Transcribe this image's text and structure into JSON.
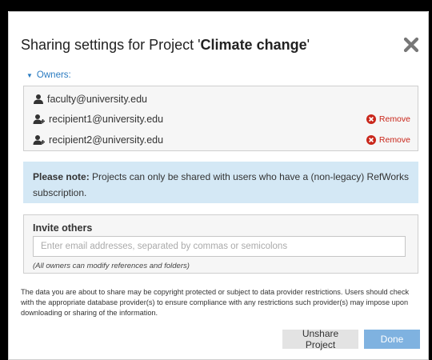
{
  "dialog": {
    "title_prefix": "Sharing settings for Project '",
    "project_name": "Climate change",
    "title_suffix": "'"
  },
  "owners": {
    "toggle_label": "Owners:",
    "items": [
      {
        "email": "faculty@university.edu",
        "icon": "person-icon",
        "removable": false
      },
      {
        "email": "recipient1@university.edu",
        "icon": "shared-user-icon",
        "removable": true
      },
      {
        "email": "recipient2@university.edu",
        "icon": "shared-user-icon",
        "removable": true
      }
    ],
    "remove_label": "Remove"
  },
  "note": {
    "lead": "Please note:",
    "text": " Projects can only be shared with users who have a (non-legacy) RefWorks subscription."
  },
  "invite": {
    "label": "Invite others",
    "value": "",
    "placeholder": "Enter email addresses, separated by commas or semicolons",
    "hint": "(All owners can modify references and folders)"
  },
  "disclaimer": "The data you are about to share may be copyright protected or subject to data provider restrictions. Users should check with the appropriate database provider(s) to ensure compliance with any restrictions such provider(s) may impose upon downloading or sharing of the information.",
  "buttons": {
    "unshare": "Unshare Project",
    "done": "Done"
  },
  "colors": {
    "link": "#2a7bc1",
    "remove": "#c9271b",
    "note_bg": "#d4e8f5",
    "done_bg": "#7fb2e0"
  }
}
